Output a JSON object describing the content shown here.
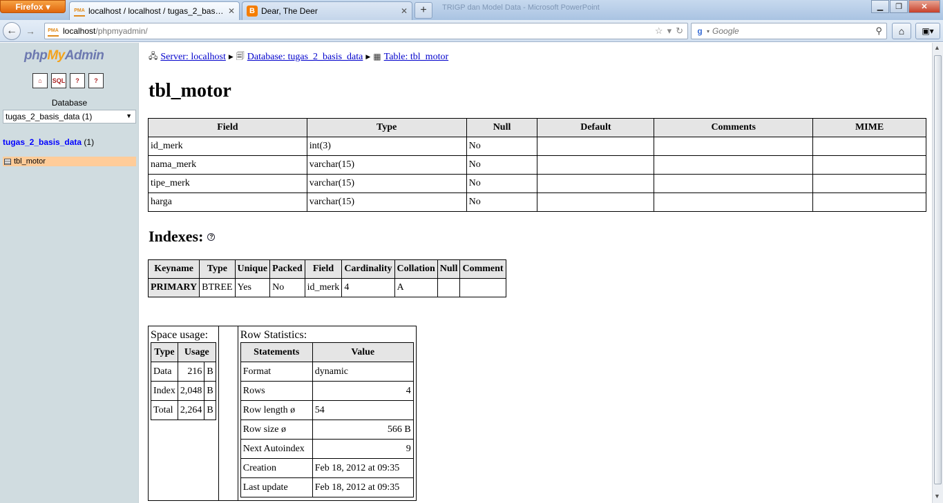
{
  "browser": {
    "menu_button": "Firefox",
    "tabs": [
      {
        "title": "localhost / localhost / tugas_2_basis_...",
        "favicon": "PMA"
      },
      {
        "title": "Dear, The Deer",
        "favicon": "B"
      }
    ],
    "background_window_title": "TRIGP dan Model Data - Microsoft PowerPoint",
    "url_host": "localhost",
    "url_path": "/phpmyadmin/",
    "search_placeholder": "Google"
  },
  "sidebar": {
    "logo_php": "php",
    "logo_my": "My",
    "logo_admin": "Admin",
    "quick_icons": [
      "home-icon",
      "sql-icon",
      "query-window-icon",
      "docs-icon"
    ],
    "database_label": "Database",
    "database_selected": "tugas_2_basis_data (1)",
    "database_link": "tugas_2_basis_data",
    "database_count": "(1)",
    "tables": [
      "tbl_motor"
    ]
  },
  "breadcrumb": {
    "server": "Server: localhost",
    "database": "Database: tugas_2_basis_data",
    "table": "Table: tbl_motor"
  },
  "page_title": "tbl_motor",
  "structure": {
    "headers": [
      "Field",
      "Type",
      "Null",
      "Default",
      "Comments",
      "MIME"
    ],
    "rows": [
      [
        "id_merk",
        "int(3)",
        "No",
        "",
        "",
        ""
      ],
      [
        "nama_merk",
        "varchar(15)",
        "No",
        "",
        "",
        ""
      ],
      [
        "tipe_merk",
        "varchar(15)",
        "No",
        "",
        "",
        ""
      ],
      [
        "harga",
        "varchar(15)",
        "No",
        "",
        "",
        ""
      ]
    ]
  },
  "indexes": {
    "title": "Indexes:",
    "headers": [
      "Keyname",
      "Type",
      "Unique",
      "Packed",
      "Field",
      "Cardinality",
      "Collation",
      "Null",
      "Comment"
    ],
    "rows": [
      [
        "PRIMARY",
        "BTREE",
        "Yes",
        "No",
        "id_merk",
        "4",
        "A",
        "",
        ""
      ]
    ]
  },
  "space_usage": {
    "caption": "Space usage:",
    "headers": [
      "Type",
      "Usage"
    ],
    "rows": [
      [
        "Data",
        "216",
        "B"
      ],
      [
        "Index",
        "2,048",
        "B"
      ],
      [
        "Total",
        "2,264",
        "B"
      ]
    ]
  },
  "row_statistics": {
    "caption": "Row Statistics:",
    "headers": [
      "Statements",
      "Value"
    ],
    "rows": [
      [
        "Format",
        "dynamic"
      ],
      [
        "Rows",
        "4"
      ],
      [
        "Row length ø",
        "54"
      ],
      [
        "Row size  ø",
        "566 B"
      ],
      [
        "Next Autoindex",
        "9"
      ],
      [
        "Creation",
        "Feb 18, 2012 at 09:35"
      ],
      [
        "Last update",
        "Feb 18, 2012 at 09:35"
      ]
    ]
  }
}
